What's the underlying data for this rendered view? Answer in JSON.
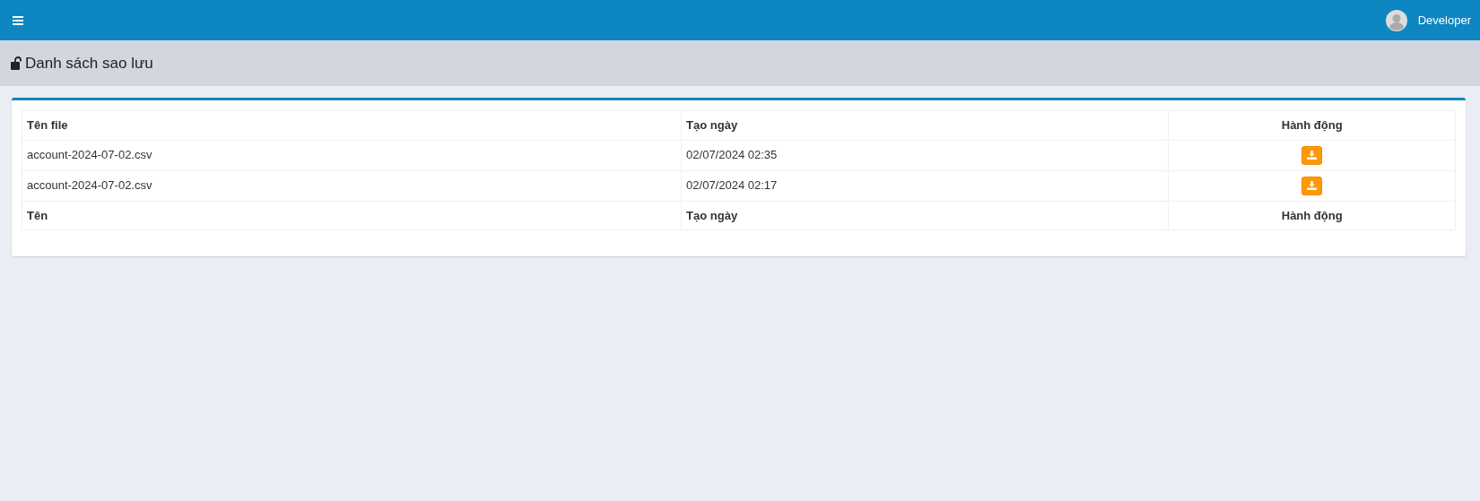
{
  "navbar": {
    "user": "Developer"
  },
  "page_title": "Danh sách sao lưu",
  "table": {
    "columns": [
      "Tên file",
      "Tạo ngày",
      "Hành động"
    ],
    "rows": [
      {
        "file": "account-2024-07-02.csv",
        "created": "02/07/2024 02:35"
      },
      {
        "file": "account-2024-07-02.csv",
        "created": "02/07/2024 02:17"
      }
    ],
    "footer": [
      "Tên",
      "Tạo ngày",
      "Hành động"
    ]
  }
}
